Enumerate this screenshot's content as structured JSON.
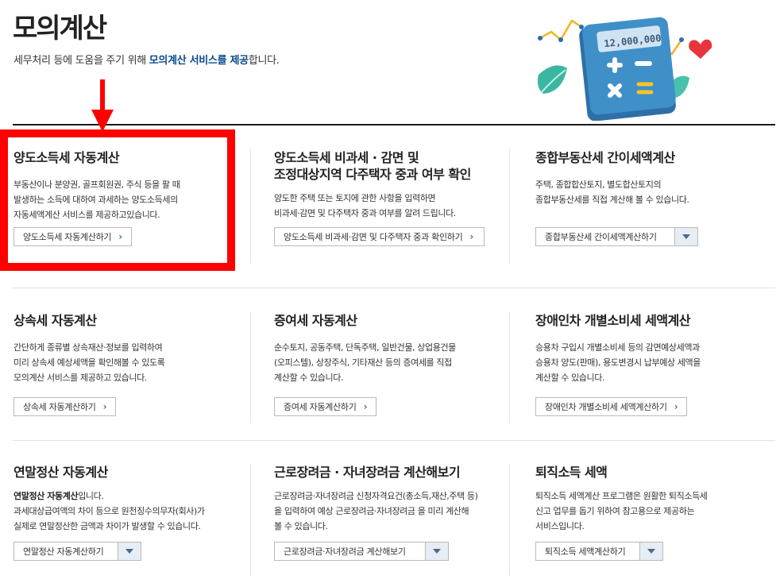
{
  "header": {
    "title": "모의계산",
    "desc_prefix": "세무처리 등에 도움을 주기 위해 ",
    "desc_highlight": "모의계산 서비스를 제공",
    "desc_suffix": "합니다.",
    "hero_amount": "12,000,000"
  },
  "colors": {
    "annotation": "#ff0000",
    "link_blue": "#0a4a8f",
    "calculator": "#3f90c8"
  },
  "cards": [
    {
      "title": "양도소득세 자동계산",
      "desc": "부동산이나 분양권, 골프회원권, 주식 등을 팔 때\n발생하는 소득에 대하여 과세하는 양도소득세의\n자동세액계산 서비스를 제공하고있습니다.",
      "button": "양도소득세 자동계산하기"
    },
    {
      "title": "양도소득세 비과세 · 감면 및\n조정대상지역 다주택자 중과 여부 확인",
      "desc": "양도한 주택 또는 토지에 관한 사항을 입력하면\n비과세·감면 및 다주택자 중과 여부를 알려 드립니다.",
      "button": "양도소득세 비과세·감면 및 다주택자 중과 확인하기"
    },
    {
      "title": "종합부동산세 간이세액계산",
      "desc": "주택, 종합합산토지, 별도합산토지의\n종합부동산세를 직접 계산해 볼 수 있습니다.",
      "button": "종합부동산세 간이세액계산하기"
    },
    {
      "title": "상속세 자동계산",
      "desc": "간단하게 종류별 상속재산·정보를 입력하여\n미리 상속세 예상세액을 확인해볼 수 있도록\n모의계산 서비스를 제공하고 있습니다.",
      "button": "상속세 자동계산하기"
    },
    {
      "title": "증여세 자동계산",
      "desc": "순수토지, 공동주택, 단독주택, 일반건물, 상업용건물\n(오피스텔), 상장주식, 기타재산 등의 증여세를 직접\n계산할 수 있습니다.",
      "button": "증여세 자동계산하기"
    },
    {
      "title": "장애인차 개별소비세 세액계산",
      "desc": "승용차 구입시 개별소비세 등의 감면예상세액과\n승용차 양도(판매), 용도변경시 납부예상 세액을\n계산할 수 있습니다.",
      "button": "장애인차 개별소비세 세액계산하기"
    },
    {
      "title": "연말정산 자동계산",
      "desc_strong": "연말정산 자동계산",
      "desc_strong_suffix": "입니다.",
      "desc": "과세대상급여액의 차이 등으로 원천징수의무자(회사)가\n실제로 연말정산한 금액과 차이가 발생할 수 있습니다.",
      "button": "연말정산 자동계산하기"
    },
    {
      "title": "근로장려금 · 자녀장려금 계산해보기",
      "desc": "근로장려금·자녀장려금 신청자격요건(총소득,재산,주택 등)\n을 입력하여 예상 근로장려금·자녀장려금 을 미리 계산해\n볼 수 있습니다.",
      "button": "근로장려금·자녀장려금 계산해보기"
    },
    {
      "title": "퇴직소득 세액",
      "desc": "퇴직소득 세액계산 프로그램은 원활한 퇴직소득세\n신고 업무를 돕기 위하여 참고용으로 제공하는\n서비스입니다.",
      "button": "퇴직소득 세액계산하기"
    }
  ]
}
